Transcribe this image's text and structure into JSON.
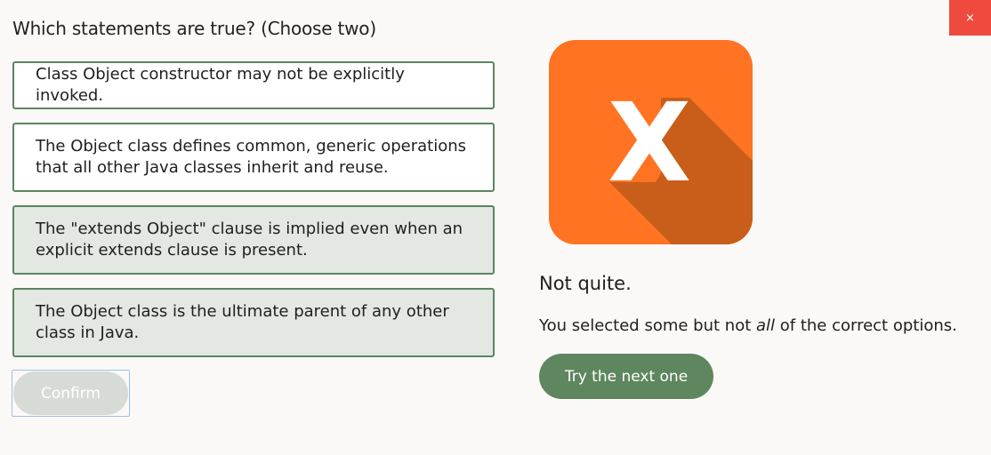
{
  "question": "Which statements are true? (Choose two)",
  "options": [
    {
      "text": "Class Object constructor may not be explicitly invoked.",
      "selected": false
    },
    {
      "text": "The Object class defines common, generic operations that all other Java classes inherit and reuse.",
      "selected": false
    },
    {
      "text": "The \"extends Object\" clause is implied even when an explicit extends clause is present.",
      "selected": true
    },
    {
      "text": "The Object class is the ultimate parent of any other class in Java.",
      "selected": true
    }
  ],
  "confirm_label": "Confirm",
  "feedback": {
    "icon": "x-mark-icon",
    "icon_letter": "X",
    "verdict": "Not quite.",
    "explanation_before": "You selected some but not ",
    "explanation_emph": "all",
    "explanation_after": " of the correct options.",
    "next_label": "Try the next one"
  },
  "close_label": "×",
  "colors": {
    "accent_green": "#5e865f",
    "selected_bg": "#e3e8e3",
    "feedback_orange": "#ff7322",
    "feedback_shadow": "#c85e1a",
    "close_red": "#f04a3e"
  }
}
